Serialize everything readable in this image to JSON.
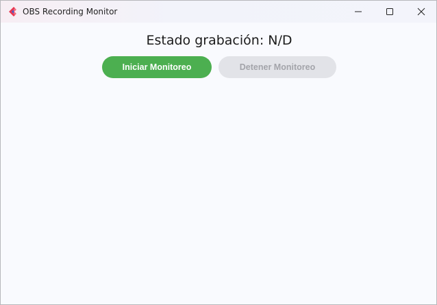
{
  "window": {
    "title": "OBS Recording Monitor",
    "controls": {
      "minimize": "minimize-icon",
      "maximize": "maximize-icon",
      "close": "close-icon"
    }
  },
  "status": {
    "label": "Estado grabación:",
    "value": "N/D"
  },
  "buttons": {
    "start_label": "Iniciar Monitoreo",
    "stop_label": "Detener Monitoreo",
    "stop_enabled": false
  },
  "colors": {
    "start_button": "#4caf50",
    "stop_button_disabled": "#e2e3e8",
    "background": "#f9fafe"
  }
}
